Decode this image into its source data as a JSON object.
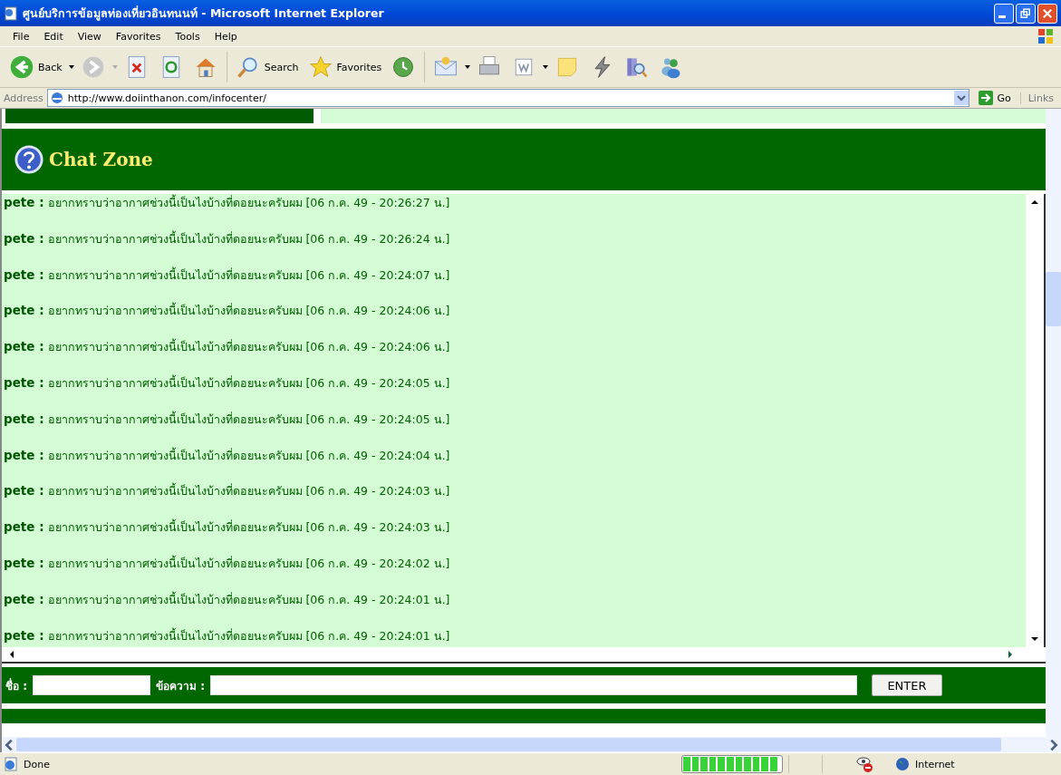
{
  "window": {
    "title": "ศูนย์บริการข้อมูลท่องเที่ยวอินทนนท์ - Microsoft Internet Explorer"
  },
  "menu": [
    "File",
    "Edit",
    "View",
    "Favorites",
    "Tools",
    "Help"
  ],
  "toolbar": [
    {
      "kind": "back",
      "label": "Back"
    },
    {
      "kind": "forward"
    },
    {
      "kind": "stop"
    },
    {
      "kind": "refresh"
    },
    {
      "kind": "home"
    },
    {
      "kind": "search",
      "label": "Search"
    },
    {
      "kind": "favorites",
      "label": "Favorites"
    },
    {
      "kind": "history"
    },
    {
      "kind": "mail"
    },
    {
      "kind": "print"
    },
    {
      "kind": "edit"
    },
    {
      "kind": "note"
    },
    {
      "kind": "bolt"
    },
    {
      "kind": "research"
    },
    {
      "kind": "messenger"
    }
  ],
  "address": {
    "label": "Address",
    "value": "http://www.doiinthanon.com/infocenter/",
    "go": "Go",
    "links": "Links"
  },
  "chat": {
    "title": "Chat Zone",
    "messages": [
      "**pete :** อยากทราบว่าอากาศช่วงนี้เป็นไงบ้างที่ดอยนะครับผม [06 ก.ค. 49 - 20:26:27 น.]",
      "**pete :** อยากทราบว่าอากาศช่วงนี้เป็นไงบ้างที่ดอยนะครับผม [06 ก.ค. 49 - 20:26:24 น.]",
      "**pete :** อยากทราบว่าอากาศช่วงนี้เป็นไงบ้างที่ดอยนะครับผม [06 ก.ค. 49 - 20:24:07 น.]",
      "**pete :** อยากทราบว่าอากาศช่วงนี้เป็นไงบ้างที่ดอยนะครับผม [06 ก.ค. 49 - 20:24:06 น.]",
      "**pete :** อยากทราบว่าอากาศช่วงนี้เป็นไงบ้างที่ดอยนะครับผม [06 ก.ค. 49 - 20:24:06 น.]",
      "**pete :** อยากทราบว่าอากาศช่วงนี้เป็นไงบ้างที่ดอยนะครับผม [06 ก.ค. 49 - 20:24:05 น.]",
      "**pete :** อยากทราบว่าอากาศช่วงนี้เป็นไงบ้างที่ดอยนะครับผม [06 ก.ค. 49 - 20:24:05 น.]",
      "**pete :** อยากทราบว่าอากาศช่วงนี้เป็นไงบ้างที่ดอยนะครับผม [06 ก.ค. 49 - 20:24:04 น.]",
      "**pete :** อยากทราบว่าอากาศช่วงนี้เป็นไงบ้างที่ดอยนะครับผม [06 ก.ค. 49 - 20:24:03 น.]",
      "**pete :** อยากทราบว่าอากาศช่วงนี้เป็นไงบ้างที่ดอยนะครับผม [06 ก.ค. 49 - 20:24:03 น.]",
      "**pete :** อยากทราบว่าอากาศช่วงนี้เป็นไงบ้างที่ดอยนะครับผม [06 ก.ค. 49 - 20:24:02 น.]",
      "**pete :** อยากทราบว่าอากาศช่วงนี้เป็นไงบ้างที่ดอยนะครับผม [06 ก.ค. 49 - 20:24:01 น.]",
      "**pete :** อยากทราบว่าอากาศช่วงนี้เป็นไงบ้างที่ดอยนะครับผม [06 ก.ค. 49 - 20:24:01 น.]"
    ],
    "name_label": "ชื่อ :",
    "message_label": "ข้อความ :",
    "submit": "ENTER"
  },
  "status_bar": {
    "text": "Done",
    "progress": {
      "level": 1
    },
    "zone": "Internet"
  }
}
